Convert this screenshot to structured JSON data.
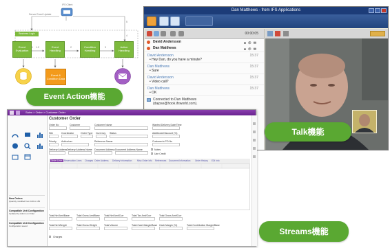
{
  "colors": {
    "green": "#7dba3d",
    "pill_green": "#5aa832",
    "orange": "#f39a1b",
    "yellow": "#f7d24a",
    "purple": "#a35fc4",
    "streams_purple": "#7a2ea0",
    "talk_blue": "#1c3c78"
  },
  "event_action": {
    "pill_label": "Event Action機能",
    "ifs_client_label": "IFS Client",
    "server_event_label": "Server Event Update",
    "business_logic": "Business Logic",
    "boxes": [
      "Event Evaluation",
      "Event Handling",
      "Condition Handling",
      "Action Handling"
    ],
    "numbers": [
      "1",
      "1.2",
      "2",
      "3",
      "4",
      "5"
    ],
    "orange_box": "Event & Condition Data",
    "icons": [
      "database-icon",
      "mail-icon"
    ]
  },
  "talk": {
    "pill_label": "Talk機能",
    "window_title": "Dan Matthews - from IFS Applications",
    "timer": "00:00:05",
    "contacts": [
      {
        "name": "David Andersson"
      },
      {
        "name": "Dan Matthews"
      }
    ],
    "messages": [
      {
        "who": "David Andersson",
        "time": "15:37",
        "text": "Hey Dan, do you have a minute?"
      },
      {
        "who": "Dan Matthews",
        "time": "15:37",
        "text": "Sure"
      },
      {
        "who": "David Andersson",
        "time": "15:37",
        "text": "Video call?"
      },
      {
        "who": "Dan Matthews",
        "time": "15:37",
        "text": "OK"
      }
    ],
    "connected_text": "Connected to Dan Matthews",
    "connected_addr": "(dajose@hook.ifsworld.com)."
  },
  "streams": {
    "pill_label": "Streams機能",
    "title": "Customer Order",
    "bar_text": "Sales  >  Order  >  Customer Order",
    "tabs": [
      "Order Lines",
      "Reservation Lines",
      "Charges",
      "Order Address",
      "Delivery Information",
      "Misc Order Info",
      "References",
      "Document Information",
      "Order History",
      "EDI Info"
    ],
    "fields": [
      "Order No",
      "Customer",
      "Customer Name",
      "Wanted Delivery Date/Time",
      "Site",
      "Coordinator",
      "Order Type",
      "Currency",
      "Status",
      "Additional Discount (%)",
      "Priority",
      "Authorizer",
      "Reference Name",
      "Customer's PO No",
      "Delivery Address",
      "Delivery Address Name",
      "Document Address",
      "Document Address Name",
      "Notes",
      "Use Credit"
    ],
    "totals": [
      "Total Net Amt/Base",
      "Total Gross Amt/Base",
      "Total Net Amt/Curr",
      "Total Tax Amt/Curr",
      "Total Gross Amt/Curr",
      "Total Net Weight",
      "Total Gross Weight",
      "Total Volume",
      "Total Cash Margin/Base",
      "Cash Margin (%)",
      "Total Contribution Margin/Base"
    ],
    "charges_label": "Charges",
    "feed": [
      {
        "title": "New Orders",
        "text": "Quantity modified from 100 to 150"
      },
      {
        "title": "Compatible Unit Configuration",
        "text": "Updated by Admin on Order"
      },
      {
        "title": "Compatible Unit Configuration",
        "text": "Configuration saved"
      }
    ]
  }
}
